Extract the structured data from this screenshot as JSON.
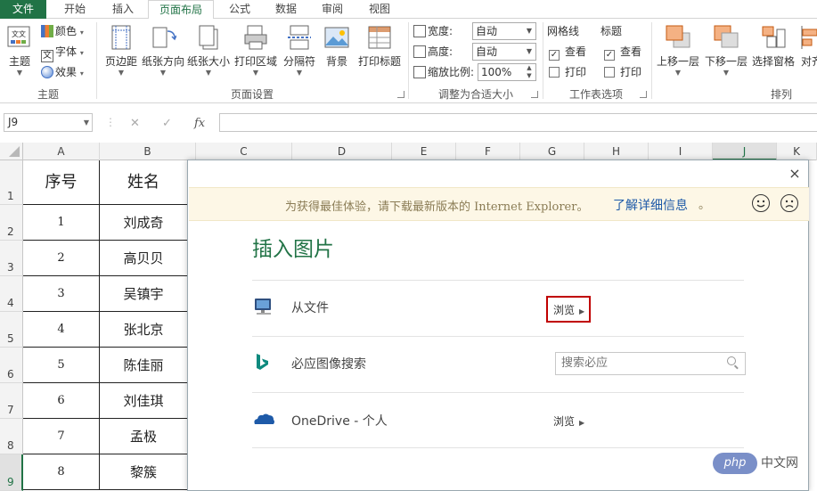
{
  "tabs": [
    {
      "label": "文件",
      "type": "file"
    },
    {
      "label": "开始",
      "type": "normal"
    },
    {
      "label": "插入",
      "type": "normal"
    },
    {
      "label": "页面布局",
      "type": "active"
    },
    {
      "label": "公式",
      "type": "normal"
    },
    {
      "label": "数据",
      "type": "normal"
    },
    {
      "label": "审阅",
      "type": "normal"
    },
    {
      "label": "视图",
      "type": "normal"
    }
  ],
  "ribbon": {
    "theme_group": {
      "label": "主题",
      "themes_btn": "主题",
      "colors": "颜色",
      "fonts": "字体",
      "effects": "效果"
    },
    "page_setup_group": {
      "label": "页面设置",
      "margins": "页边距",
      "orientation": "纸张方向",
      "size": "纸张大小",
      "print_area": "打印区域",
      "breaks": "分隔符",
      "background": "背景",
      "print_titles": "打印标题"
    },
    "scale_group": {
      "label": "调整为合适大小",
      "width_label": "宽度:",
      "width_value": "自动",
      "height_label": "高度:",
      "height_value": "自动",
      "scale_label": "缩放比例:",
      "scale_value": "100%"
    },
    "sheet_options_group": {
      "label": "工作表选项",
      "gridlines": "网格线",
      "headings": "标题",
      "view": "查看",
      "print": "打印",
      "gridlines_view_checked": true,
      "gridlines_print_checked": false,
      "headings_view_checked": true,
      "headings_print_checked": false
    },
    "arrange_group": {
      "label": "排列",
      "bring_forward": "上移一层",
      "send_backward": "下移一层",
      "selection_pane": "选择窗格",
      "align": "对齐"
    }
  },
  "formula_bar": {
    "name_box": "J9",
    "cancel": "✕",
    "enter": "✓",
    "fx": "fx"
  },
  "columns": [
    "A",
    "B",
    "C",
    "D",
    "E",
    "F",
    "G",
    "H",
    "I",
    "J",
    "K"
  ],
  "selected_column": "J",
  "rows": [
    "1",
    "2",
    "3",
    "4",
    "5",
    "6",
    "7",
    "8",
    "9"
  ],
  "selected_row": "9",
  "table": {
    "headers": [
      "序号",
      "姓名"
    ],
    "rows": [
      [
        "1",
        "刘成奇"
      ],
      [
        "2",
        "高贝贝"
      ],
      [
        "3",
        "吴镇宇"
      ],
      [
        "4",
        "张北京"
      ],
      [
        "5",
        "陈佳丽"
      ],
      [
        "6",
        "刘佳琪"
      ],
      [
        "7",
        "孟极"
      ],
      [
        "8",
        "黎簇"
      ]
    ]
  },
  "dialog": {
    "close": "×",
    "ie_message": "为获得最佳体验，请下载最新版本的 Internet Explorer。",
    "ie_link": "了解详细信息",
    "ie_dot": "。",
    "title": "插入图片",
    "options": [
      {
        "label": "从文件",
        "action": "浏览",
        "icon": "computer-icon"
      },
      {
        "label": "必应图像搜索",
        "placeholder": "搜索必应",
        "icon": "bing-icon"
      },
      {
        "label": "OneDrive - 个人",
        "action": "浏览",
        "icon": "onedrive-cloud-icon"
      }
    ]
  },
  "watermark": {
    "logo": "php",
    "text": "中文网"
  },
  "colors": {
    "excel_green": "#217346",
    "highlight_red": "#c00000",
    "ie_bar_bg": "#fdf7e6"
  }
}
